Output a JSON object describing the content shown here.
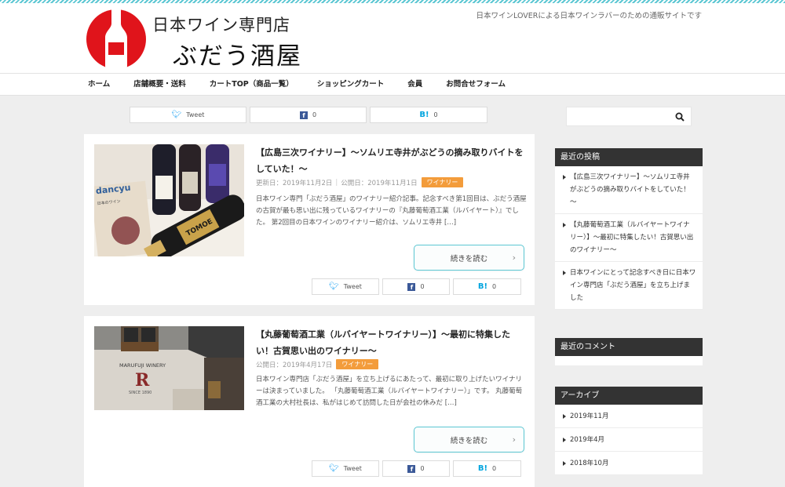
{
  "site": {
    "logo_sub": "日本ワイン専門店",
    "logo_main": "ぶだう酒屋",
    "tagline": "日本ワインLOVERによる日本ワインラバーのための通販サイトです"
  },
  "nav": [
    "ホーム",
    "店舗概要・送料",
    "カートTOP（商品一覧）",
    "ショッピングカート",
    "会員",
    "お問合せフォーム"
  ],
  "share": {
    "tweet": "Tweet",
    "fb_count": "0",
    "hb_label": "B!",
    "hb_count": "0"
  },
  "posts": [
    {
      "title": "【広島三次ワイナリー】～ソムリエ寺井がぶどうの摘み取りバイトをしていた！～",
      "updated": "更新日：2019年11月2日",
      "published": "公開日：2019年11月1日",
      "category": "ワイナリー",
      "excerpt": "日本ワイン専門「ぶだう酒屋」のワイナリー紹介記事。記念すべき第1回目は、ぶだう酒屋の古賀が最も思い出に残っているワイナリーの『丸藤葡萄酒工業（ルバイヤート）』でした。 第2回目の日本ワインのワイナリー紹介は、ソムリエ寺井 […]",
      "more": "続きを読む",
      "thumb_labels": {
        "bottle": "TOMOE",
        "magazine": "dancyu",
        "magazine_spine": "日本のワイン"
      }
    },
    {
      "title": "【丸藤葡萄酒工業（ルバイヤートワイナリー）】～最初に特集したい！古賀思い出のワイナリー～",
      "published": "公開日：2019年4月17日",
      "category": "ワイナリー",
      "excerpt": "日本ワイン専門店「ぶだう酒屋」を立ち上げるにあたって、最初に取り上げたいワイナリーは決まっていました。 「丸藤葡萄酒工業（ルバイヤートワイナリー）」です。 丸藤葡萄酒工業の大村社長は、私がはじめて訪問した日が会社の休みだ […]",
      "more": "続きを読む",
      "thumb_labels": {
        "sign": "MARUFUJI WINERY",
        "since": "SINCE 1890"
      }
    }
  ],
  "sidebar": {
    "search_placeholder": "",
    "recent_posts_title": "最近の投稿",
    "recent_posts": [
      "【広島三次ワイナリー】～ソムリエ寺井がぶどうの摘み取りバイトをしていた！～",
      "【丸藤葡萄酒工業（ルバイヤートワイナリー）】～最初に特集したい！古賀思い出のワイナリー～",
      "日本ワインにとって記念すべき日に日本ワイン専門店「ぶだう酒屋」を立ち上げました"
    ],
    "recent_comments_title": "最近のコメント",
    "archives_title": "アーカイブ",
    "archives": [
      "2019年11月",
      "2019年4月",
      "2018年10月"
    ]
  },
  "colors": {
    "accent": "#5cc7d3",
    "badge": "#f39c3b",
    "widget_head": "#333333",
    "logo_red": "#e0141b"
  }
}
